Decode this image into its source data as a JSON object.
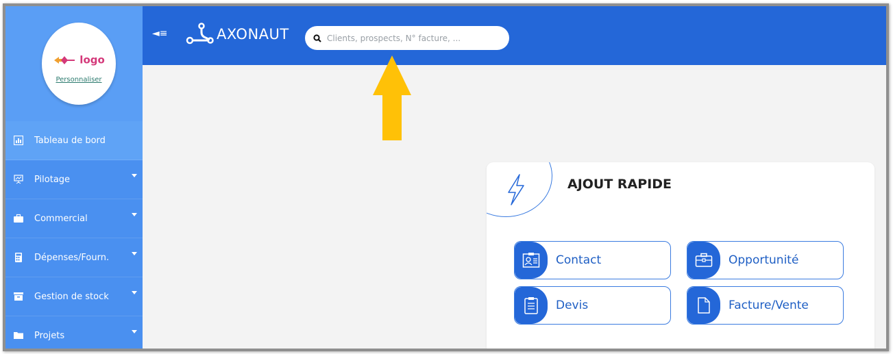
{
  "app": {
    "name": "AXONAUT"
  },
  "logo": {
    "text": "logo",
    "customize_link": "Personnaliser"
  },
  "sidebar": {
    "items": [
      {
        "label": "Tableau de bord",
        "icon": "dashboard-icon",
        "active": true,
        "has_caret": false
      },
      {
        "label": "Pilotage",
        "icon": "presentation-icon",
        "active": false,
        "has_caret": true
      },
      {
        "label": "Commercial",
        "icon": "briefcase-icon",
        "active": false,
        "has_caret": true
      },
      {
        "label": "Dépenses/Fourn.",
        "icon": "calculator-icon",
        "active": false,
        "has_caret": true
      },
      {
        "label": "Gestion de stock",
        "icon": "archive-icon",
        "active": false,
        "has_caret": true
      },
      {
        "label": "Projets",
        "icon": "folder-icon",
        "active": false,
        "has_caret": true
      }
    ]
  },
  "search": {
    "placeholder": "Clients, prospects, N° facture, ..."
  },
  "quick_add": {
    "title": "AJOUT RAPIDE",
    "buttons": [
      {
        "label": "Contact",
        "icon": "contact-card-icon"
      },
      {
        "label": "Opportunité",
        "icon": "briefcase-icon"
      },
      {
        "label": "Devis",
        "icon": "clipboard-icon"
      },
      {
        "label": "Facture/Vente",
        "icon": "document-icon"
      }
    ]
  },
  "colors": {
    "header": "#2467d8",
    "sidebar": "#4a90f0",
    "accent": "#1f5fc4",
    "arrow": "#ffc107",
    "logo_text": "#d4397a"
  }
}
